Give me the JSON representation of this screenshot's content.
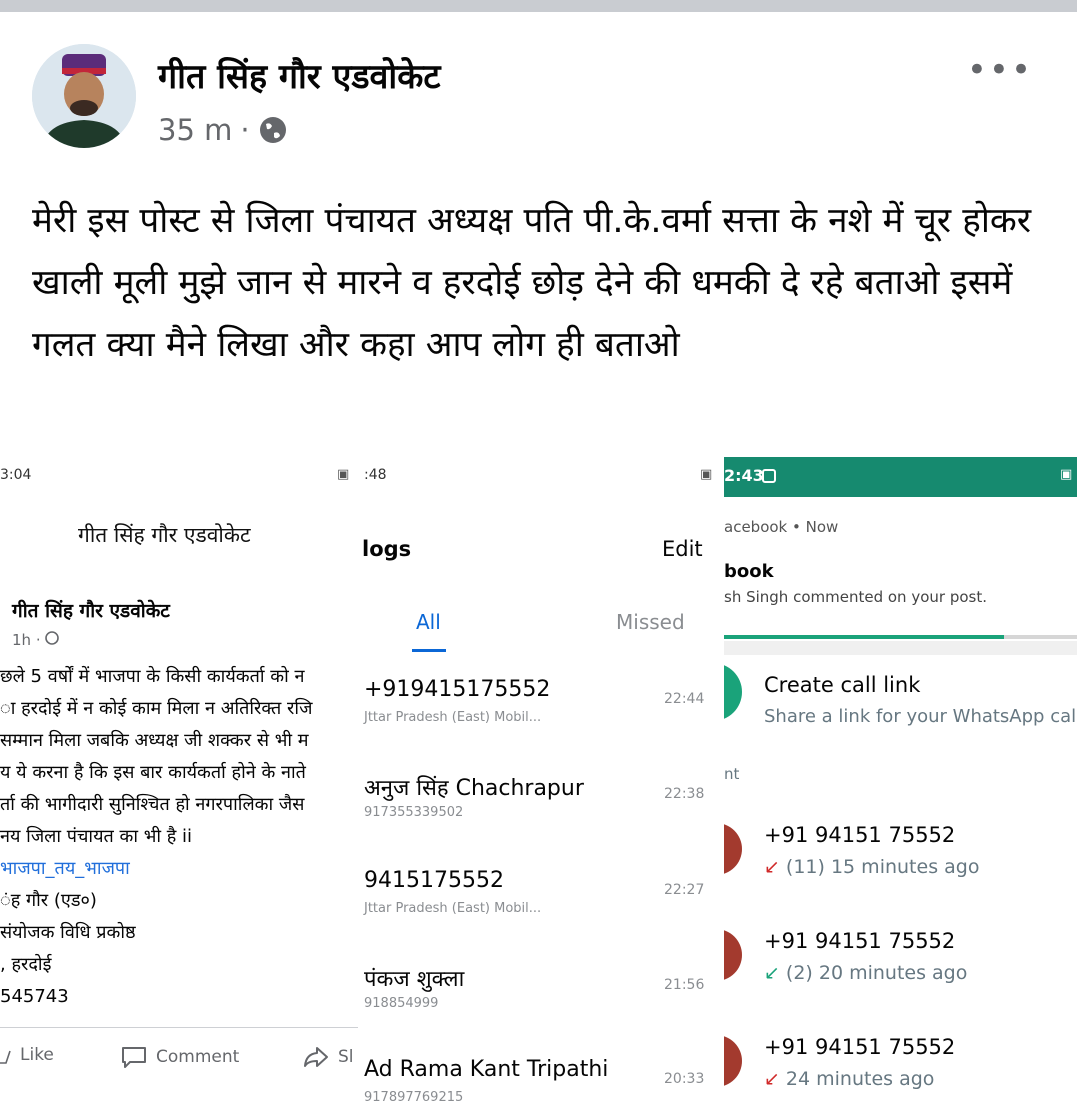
{
  "post": {
    "author": "गीत सिंह गौर एडवोकेट",
    "time": "35 m",
    "dot": "·",
    "more_icon": "•••",
    "text": "मेरी इस पोस्ट से जिला पंचायत अध्यक्ष पति पी.के.वर्मा सत्ता के नशे में चूर होकर खाली मूली मुझे जान से मारने व हरदोई छोड़ देने की धमकी दे रहे बताओ इसमें गलत क्या मैने लिखा और कहा आप लोग ही बताओ"
  },
  "shot1": {
    "status_time": "3:04",
    "title": "गीत सिंह गौर एडवोकेट",
    "post_author": "गीत सिंह गौर एडवोकेट",
    "post_time": "1h ·",
    "lines": [
      "छले 5 वर्षों में भाजपा के किसी कार्यकर्ता को न",
      "ा हरदोई में न कोई काम मिला न अतिरिक्त रजि",
      "सम्मान मिला जबकि अध्यक्ष जी शक्कर से भी म",
      "य ये करना है कि इस बार कार्यकर्ता होने के नाते",
      "र्ता की भागीदारी सुनिश्चित हो नगरपालिका जैस",
      "नय जिला पंचायत का भी है ii",
      "भाजपा_तय_भाजपा",
      "ंह गौर (एड०)",
      "संयोजक विधि प्रकोष्ठ",
      ", हरदोई",
      "545743"
    ],
    "like": "Like",
    "comment": "Comment",
    "share": "Sl"
  },
  "shot2": {
    "status_time": ":48",
    "title": "logs",
    "edit": "Edit",
    "tab_all": "All",
    "tab_missed": "Missed",
    "rows": [
      {
        "name": "+919415175552",
        "sub": "Jttar Pradesh (East) Mobil...",
        "time": "22:44"
      },
      {
        "name": "अनुज सिंह Chachrapur",
        "sub": "917355339502",
        "time": "22:38"
      },
      {
        "name": "9415175552",
        "sub": "Jttar Pradesh (East) Mobil...",
        "time": "22:27"
      },
      {
        "name": "पंकज शुक्ला",
        "sub": "918854999",
        "time": "21:56"
      },
      {
        "name": "Ad Rama Kant Tripathi",
        "sub": "917897769215",
        "time": "20:33"
      }
    ]
  },
  "shot3": {
    "status_time": "2:43",
    "notif_app": "acebook • Now",
    "notif_title": "book",
    "notif_body": "sh Singh commented on your post.",
    "link_title": "Create call link",
    "link_sub": "Share a link for your WhatsApp cal",
    "recent": "nt",
    "calls": [
      {
        "number": "+91 94151 75552",
        "detail": "(11) 15 minutes ago",
        "arrow": "↙",
        "missed": true
      },
      {
        "number": "+91 94151 75552",
        "detail": "(2) 20 minutes ago",
        "arrow": "↙",
        "missed": false
      },
      {
        "number": "+91 94151 75552",
        "detail": "24 minutes ago",
        "arrow": "↙",
        "missed": true
      }
    ]
  }
}
